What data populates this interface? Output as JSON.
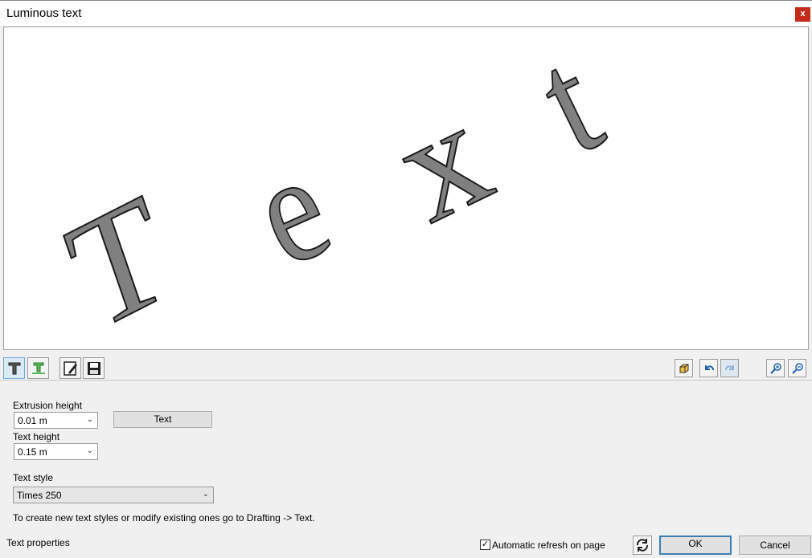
{
  "window": {
    "title": "Luminous text",
    "close_label": "x"
  },
  "preview": {
    "letters": [
      "T",
      "e",
      "x",
      "t"
    ],
    "face_color": "#808080",
    "outline_color": "#1a1a1a"
  },
  "toolbar": {
    "left_icons": [
      "text-mode-icon",
      "text-ground-icon",
      "edit-icon",
      "save-icon"
    ],
    "right_icons": [
      "cube-view-icon",
      "undo-icon",
      "redo-icon",
      "zoom-in-icon",
      "zoom-out-icon"
    ]
  },
  "form": {
    "extrusion_label": "Extrusion height",
    "extrusion_value": "0.01 m",
    "text_button": "Text",
    "text_height_label": "Text height",
    "text_height_value": "0.15 m",
    "text_style_label": "Text style",
    "text_style_value": "Times 250",
    "hint": "To create new text styles or modify existing ones go to Drafting -> Text."
  },
  "footer": {
    "section_label": "Text properties",
    "auto_refresh_label": "Automatic refresh on page",
    "auto_refresh_checked": true,
    "ok_label": "OK",
    "cancel_label": "Cancel"
  }
}
